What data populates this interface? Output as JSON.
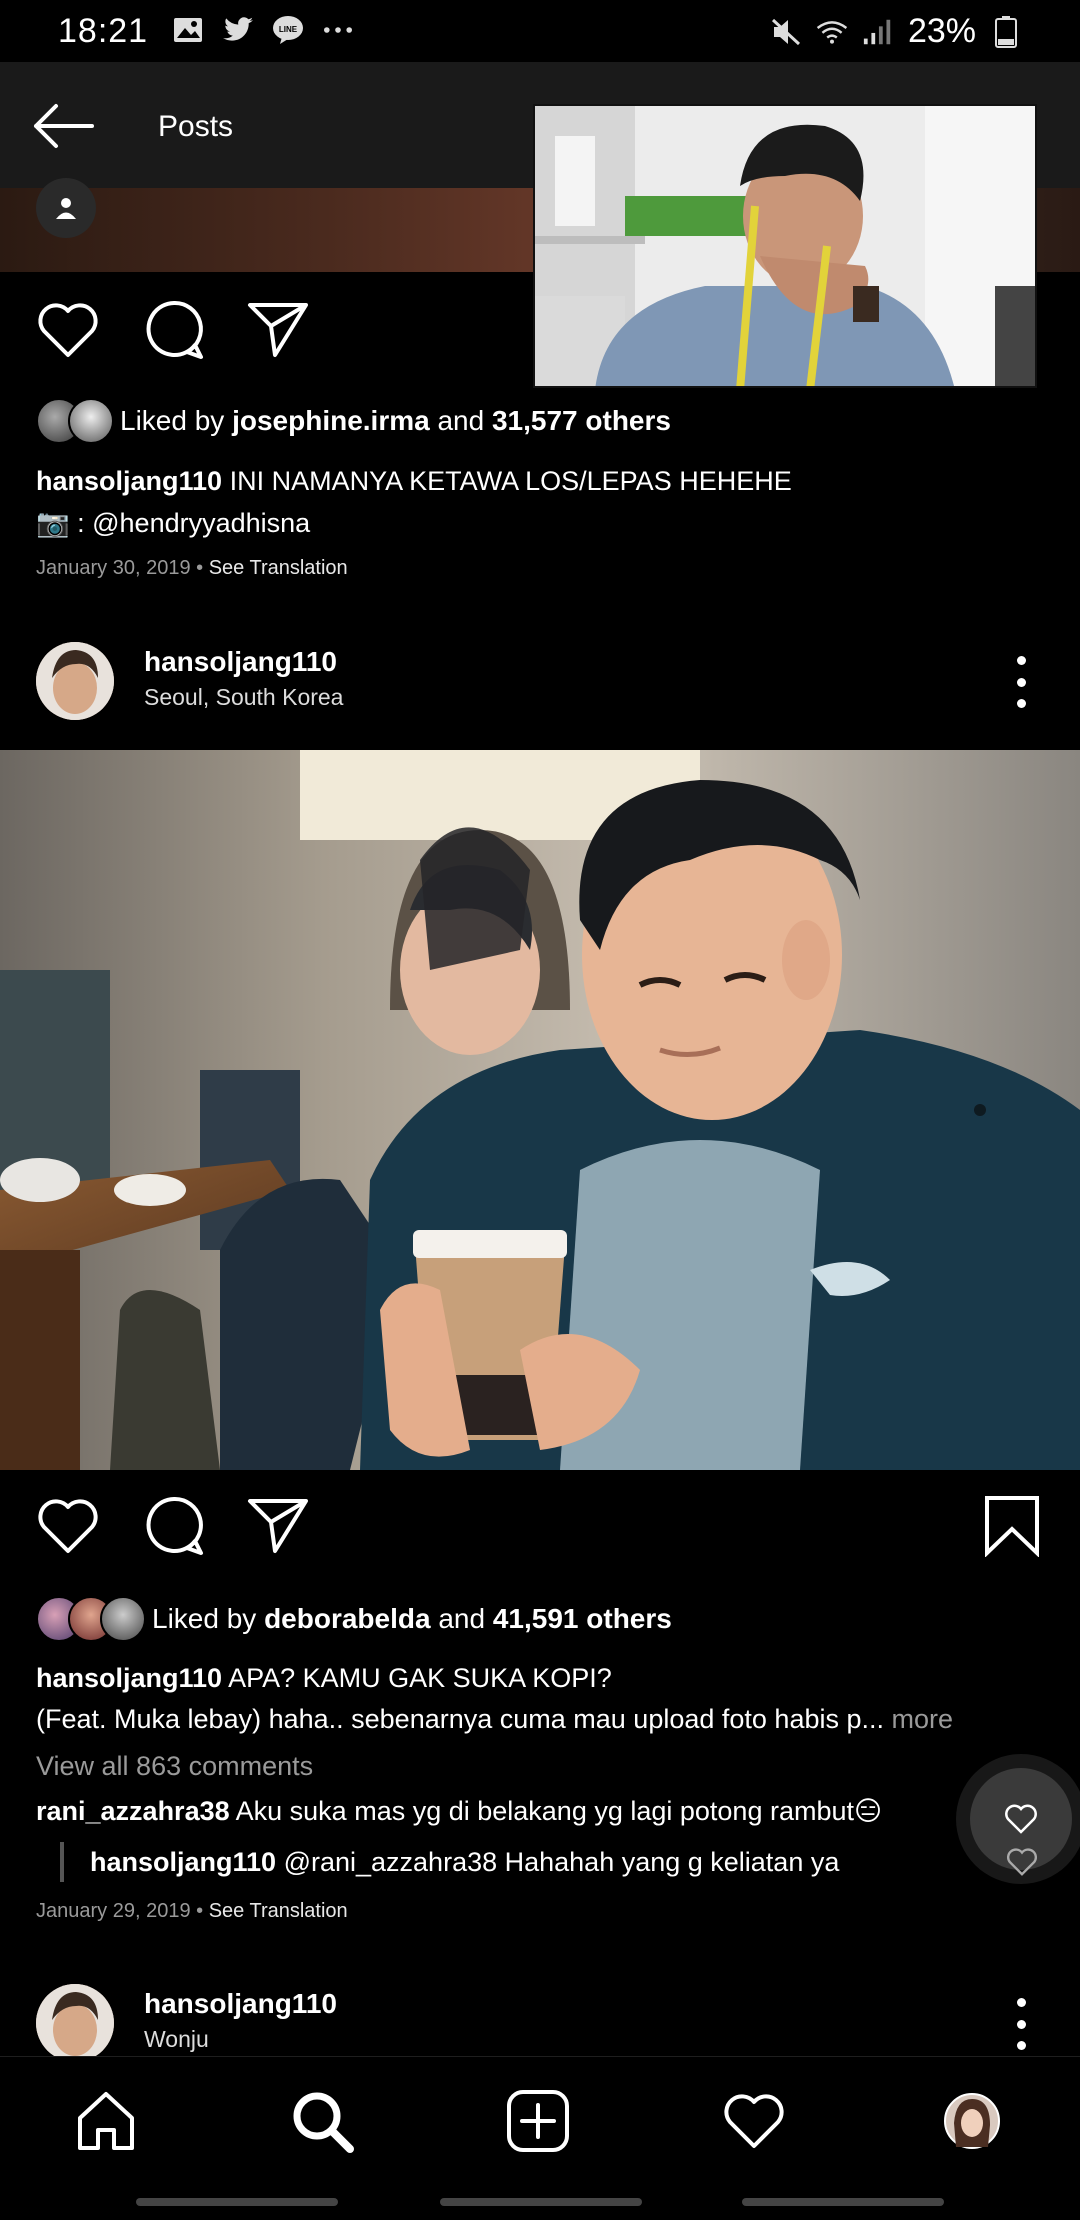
{
  "status_bar": {
    "time": "18:21",
    "battery": "23%"
  },
  "header": {
    "title": "Posts"
  },
  "post1": {
    "liked_prefix": "Liked by ",
    "liked_user": "josephine.irma",
    "liked_and": " and ",
    "liked_count": "31,577 others",
    "caption_user": "hansoljang110",
    "caption_text": " INI NAMANYA KETAWA LOS/LEPAS HEHEHE",
    "caption_line2": "📷 : @hendryyadhisna",
    "date": "January 30, 2019",
    "date_sep": " • ",
    "see_translation": "See Translation"
  },
  "post2": {
    "username": "hansoljang110",
    "location": "Seoul, South Korea",
    "liked_prefix": "Liked by ",
    "liked_user": "deborabelda",
    "liked_and": " and ",
    "liked_count": "41,591 others",
    "caption_user": "hansoljang110",
    "caption_text": " APA? KAMU GAK SUKA KOPI?",
    "caption_line2": "(Feat. Muka lebay) haha.. sebenarnya cuma mau upload foto habis p...",
    "caption_more": " more",
    "view_all": "View all 863 comments",
    "comment1_user": "rani_azzahra38",
    "comment1_text": " Aku suka mas yg di belakang yg lagi potong rambut😑",
    "reply_user": "hansoljang110",
    "reply_text": " @rani_azzahra38 Hahahah yang g keliatan ya",
    "date": "January 29, 2019",
    "date_sep": " • ",
    "see_translation": "See Translation"
  },
  "post3": {
    "username": "hansoljang110",
    "location": "Wonju"
  },
  "colors": {
    "background": "#000000",
    "header": "#1a1a1a",
    "muted_text": "#9a9a9a"
  },
  "icons": {
    "back": "arrow-left-icon",
    "like": "heart-icon",
    "comment": "comment-bubble-icon",
    "share": "paper-plane-icon",
    "save": "bookmark-icon",
    "home": "home-icon",
    "search": "search-icon",
    "add": "plus-square-icon",
    "activity": "heart-icon",
    "profile": "avatar-icon"
  }
}
